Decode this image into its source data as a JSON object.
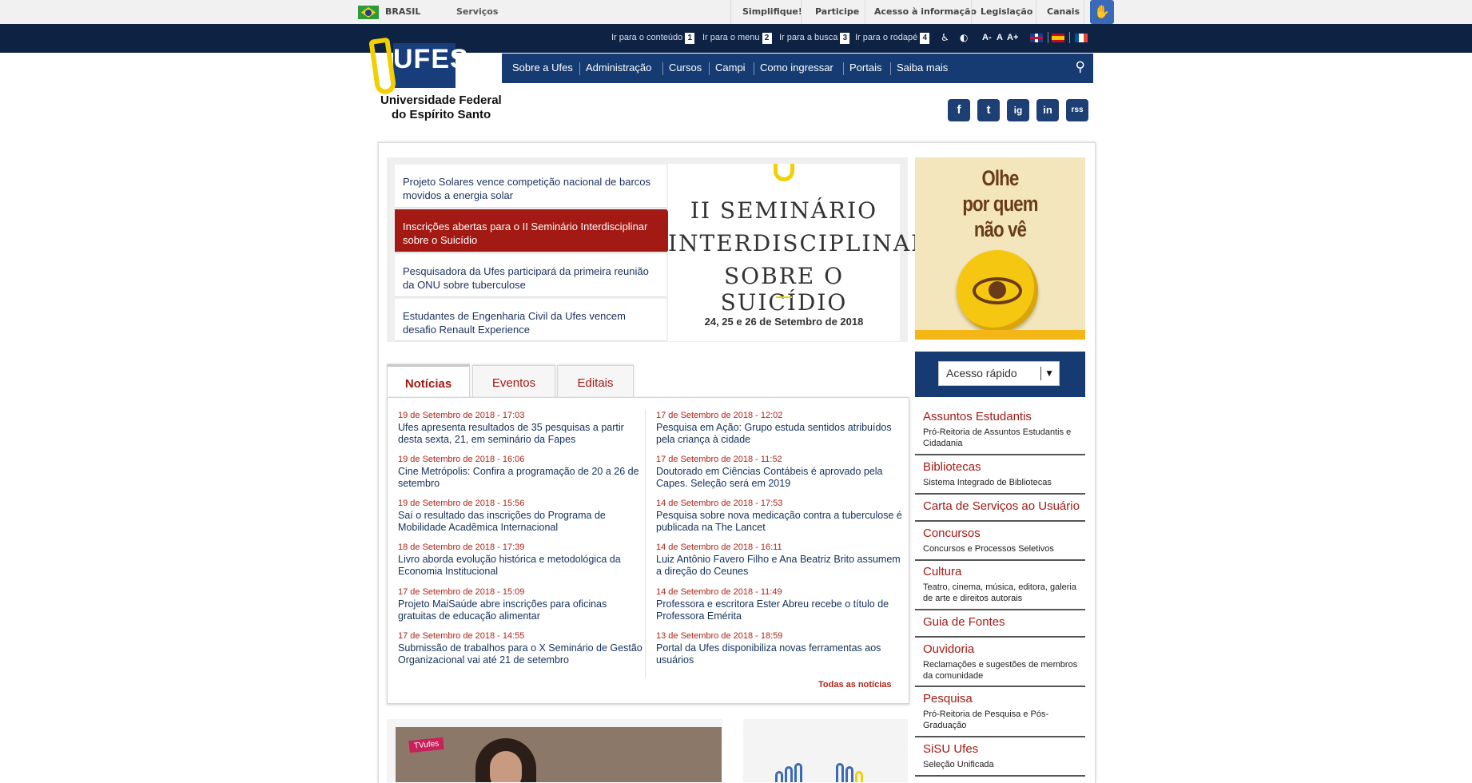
{
  "govbar": {
    "country": "BRASIL",
    "services": "Serviços",
    "links": [
      "Simplifique!",
      "Participe",
      "Acesso à informação",
      "Legislação",
      "Canais"
    ]
  },
  "accessbar": {
    "skip_links": [
      {
        "label": "Ir para o conteúdo",
        "key": "1"
      },
      {
        "label": "Ir para o menu",
        "key": "2"
      },
      {
        "label": "Ir para a busca",
        "key": "3"
      },
      {
        "label": "Ir para o rodapé",
        "key": "4"
      }
    ],
    "font_sizes": [
      "A-",
      "A",
      "A+"
    ]
  },
  "header": {
    "logo_word": "UFES",
    "name_line1": "Universidade Federal",
    "name_line2": "do Espírito Santo"
  },
  "nav": {
    "items": [
      "Sobre a Ufes",
      "Administração",
      "Cursos",
      "Campi",
      "Como ingressar",
      "Portais",
      "Saiba mais"
    ]
  },
  "social": [
    "f",
    "t",
    "ig",
    "in",
    "rss"
  ],
  "slider": {
    "items": [
      "Projeto Solares vence competição nacional de barcos movidos a energia solar",
      "Inscrições abertas para o II Seminário Interdisciplinar sobre o Suicídio",
      "Pesquisadora da Ufes participará da primeira reunião da ONU sobre tuberculose",
      "Estudantes de Engenharia Civil da Ufes vencem desafio Renault Experience"
    ],
    "active_index": 1,
    "banner": {
      "line1": "II SEMINÁRIO",
      "line2": "INTERDISCIPLINAR",
      "line3": "SOBRE O SUICÍDIO",
      "date": "24, 25 e 26 de Setembro de 2018"
    }
  },
  "promo": {
    "line1": "Olhe",
    "line2": "por quem",
    "line3": "não vê"
  },
  "tabs": [
    "Notícias",
    "Eventos",
    "Editais"
  ],
  "news": {
    "left": [
      {
        "date": "19 de Setembro de 2018 - 17:03",
        "title": "Ufes apresenta resultados de 35 pesquisas a partir desta sexta, 21, em seminário da Fapes"
      },
      {
        "date": "19 de Setembro de 2018 - 16:06",
        "title": "Cine Metrópolis: Confira a programação de 20 a 26 de setembro"
      },
      {
        "date": "19 de Setembro de 2018 - 15:56",
        "title": "Saí o resultado das inscrições do Programa de Mobilidade Acadêmica Internacional"
      },
      {
        "date": "18 de Setembro de 2018 - 17:39",
        "title": "Livro aborda evolução histórica e metodológica da Economia Institucional"
      },
      {
        "date": "17 de Setembro de 2018 - 15:09",
        "title": "Projeto MaiSaúde abre inscrições para oficinas gratuitas de educação alimentar"
      },
      {
        "date": "17 de Setembro de 2018 - 14:55",
        "title": "Submissão de trabalhos para o X Seminário de Gestão Organizacional vai até 21 de setembro"
      }
    ],
    "right": [
      {
        "date": "17 de Setembro de 2018 - 12:02",
        "title": "Pesquisa em Ação: Grupo estuda sentidos atribuídos pela criança à cidade"
      },
      {
        "date": "17 de Setembro de 2018 - 11:52",
        "title": "Doutorado em Ciências Contábeis é aprovado pela Capes. Seleção será em 2019"
      },
      {
        "date": "14 de Setembro de 2018 - 17:53",
        "title": "Pesquisa sobre nova medicação contra a tuberculose é publicada na The Lancet"
      },
      {
        "date": "14 de Setembro de 2018 - 16:11",
        "title": "Luiz Antônio Favero Filho e Ana Beatriz Brito assumem a direção do Ceunes"
      },
      {
        "date": "14 de Setembro de 2018 - 11:49",
        "title": "Professora e escritora Ester Abreu recebe o título de Professora Emérita"
      },
      {
        "date": "13 de Setembro de 2018 - 18:59",
        "title": "Portal da Ufes disponibiliza novas ferramentas aos usuários"
      }
    ],
    "all_link": "Todas as notícias"
  },
  "quick_access": {
    "placeholder": "Acesso rápido"
  },
  "sidebar": [
    {
      "title": "Assuntos Estudantis",
      "sub": "Pró-Reitoria de Assuntos Estudantis e Cidadania"
    },
    {
      "title": "Bibliotecas",
      "sub": "Sistema Integrado de Bibliotecas"
    },
    {
      "title": "Carta de Serviços ao Usuário",
      "sub": ""
    },
    {
      "title": "Concursos",
      "sub": "Concursos e Processos Seletivos"
    },
    {
      "title": "Cultura",
      "sub": "Teatro, cinema, música, editora, galeria de arte e direitos autorais"
    },
    {
      "title": "Guia de Fontes",
      "sub": ""
    },
    {
      "title": "Ouvidoria",
      "sub": "Reclamações e sugestões de membros da comunidade"
    },
    {
      "title": "Pesquisa",
      "sub": "Pró-Reitoria de Pesquisa e Pós-Graduação"
    },
    {
      "title": "SiSU Ufes",
      "sub": "Seleção Unificada"
    }
  ],
  "video": {
    "badge": "TVufes"
  },
  "colors": {
    "navy": "#153b72",
    "dark_bar": "#0e2244",
    "accent_red": "#a31a14",
    "ribbon_yellow": "#f4cf00"
  }
}
